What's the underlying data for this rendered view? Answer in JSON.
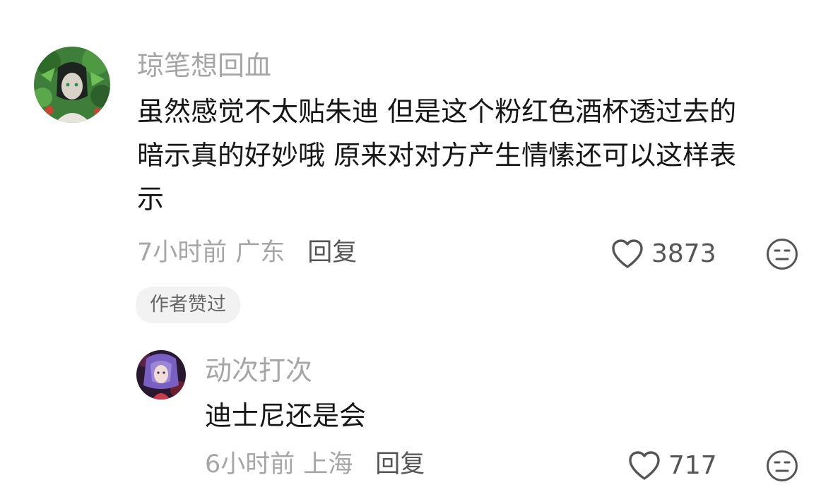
{
  "comment": {
    "username": "琼笔想回血",
    "text_lines": [
      "虽然感觉不太贴朱迪 但是这个粉红色酒杯透过去的",
      "暗示真的好妙哦 原来对对方产生情愫还可以这样表",
      "示"
    ],
    "time": "7小时前",
    "location": "广东",
    "reply_label": "回复",
    "like_count": "3873",
    "author_badge": "作者赞过",
    "avatar_icon": "avatar-green-plant-character"
  },
  "reply": {
    "username": "动次打次",
    "text": "迪士尼还是会",
    "time": "6小时前",
    "location": "上海",
    "reply_label": "回复",
    "like_count": "717",
    "avatar_icon": "avatar-purple-hair-character"
  },
  "icons": {
    "like": "heart-outline-icon",
    "dislike": "meh-face-icon"
  },
  "colors": {
    "username": "#a6a6a6",
    "body_text": "#161616",
    "action": "#555555",
    "badge_bg": "#f2f2f2"
  }
}
